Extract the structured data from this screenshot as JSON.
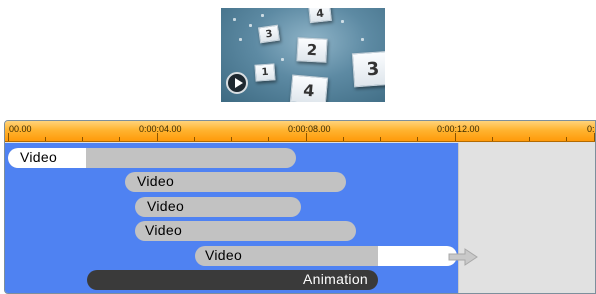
{
  "preview": {
    "cards": [
      "3",
      "4",
      "2",
      "1",
      "4",
      "3"
    ],
    "play_icon": "play-icon"
  },
  "timeline": {
    "ruler_labels": [
      "00.00",
      "0:00:04.00",
      "0:00:08.00",
      "0:00:12.00",
      "0:"
    ],
    "clips": [
      {
        "label": "Video",
        "type": "video"
      },
      {
        "label": "Video",
        "type": "video"
      },
      {
        "label": "Video",
        "type": "video"
      },
      {
        "label": "Video",
        "type": "video"
      },
      {
        "label": "Video",
        "type": "video"
      },
      {
        "label": "Animation",
        "type": "animation"
      }
    ],
    "end_icon": "arrow-right-icon"
  },
  "colors": {
    "ruler": "#ffb431",
    "track_area": "#4f82f2",
    "clip": "#c2c2c2",
    "animation_clip": "#3a3a3a",
    "empty_area": "#e1e1e1"
  }
}
